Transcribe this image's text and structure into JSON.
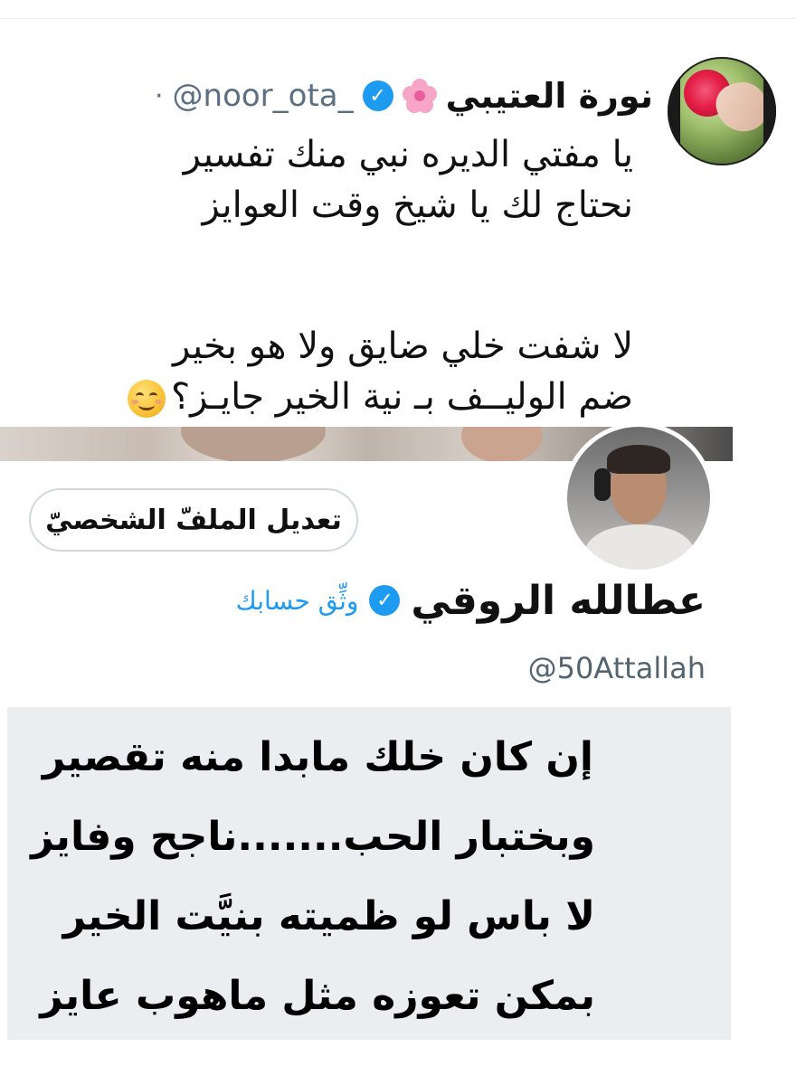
{
  "tweet": {
    "display_name": "نورة العتيبي",
    "handle": "@noor_ota_",
    "separator": "·",
    "lines": [
      "يا مفتي الديره نبي منك تفسير",
      "نحتاج لك يا شيخ  وقت العوايز",
      "لا شفت خلي ضايق ولا هو بخير",
      "ضم الوليــف بـ نية الخير جايـز؟"
    ]
  },
  "profile": {
    "edit_button": "تعديل الملفّ الشخصيّ",
    "display_name": "عطالله الروقي",
    "verify_link": "وثِّق حسابك",
    "handle": "@50Attallah",
    "poem": [
      "إن كان خلك مابدا منه تقصير",
      "وبختبار الحب.......ناجح وفايز",
      "لا باس لو ظميته بنيَّت الخير",
      "بمكن تعوزه مثل ماهوب عايز"
    ]
  },
  "colors": {
    "verified_blue": "#1d9bf0",
    "handle_gray": "#5b7083",
    "poem_bg": "#ecedf0"
  },
  "icons": {
    "verified": "verified-badge-icon",
    "flower": "cherry-blossom-emoji-icon",
    "smile": "smiling-face-emoji-icon"
  }
}
